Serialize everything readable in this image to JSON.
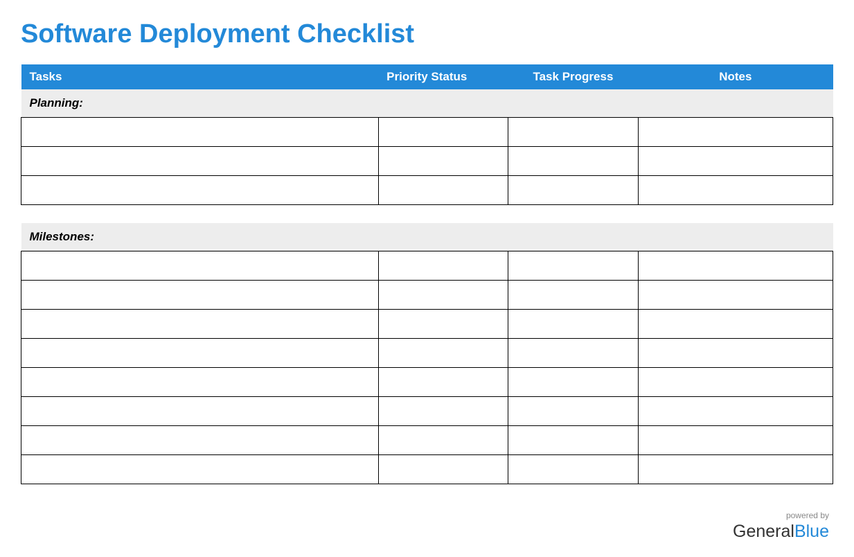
{
  "title": "Software Deployment Checklist",
  "columns": {
    "tasks": "Tasks",
    "priority": "Priority Status",
    "progress": "Task Progress",
    "notes": "Notes"
  },
  "sections": [
    {
      "label": "Planning:",
      "rows": [
        {
          "task": "",
          "priority": "",
          "progress": "",
          "notes": ""
        },
        {
          "task": "",
          "priority": "",
          "progress": "",
          "notes": ""
        },
        {
          "task": "",
          "priority": "",
          "progress": "",
          "notes": ""
        }
      ]
    },
    {
      "label": "Milestones:",
      "rows": [
        {
          "task": "",
          "priority": "",
          "progress": "",
          "notes": ""
        },
        {
          "task": "",
          "priority": "",
          "progress": "",
          "notes": ""
        },
        {
          "task": "",
          "priority": "",
          "progress": "",
          "notes": ""
        },
        {
          "task": "",
          "priority": "",
          "progress": "",
          "notes": ""
        },
        {
          "task": "",
          "priority": "",
          "progress": "",
          "notes": ""
        },
        {
          "task": "",
          "priority": "",
          "progress": "",
          "notes": ""
        },
        {
          "task": "",
          "priority": "",
          "progress": "",
          "notes": ""
        },
        {
          "task": "",
          "priority": "",
          "progress": "",
          "notes": ""
        }
      ]
    }
  ],
  "footer": {
    "powered_by": "powered by",
    "brand_general": "General",
    "brand_blue": "Blue"
  }
}
